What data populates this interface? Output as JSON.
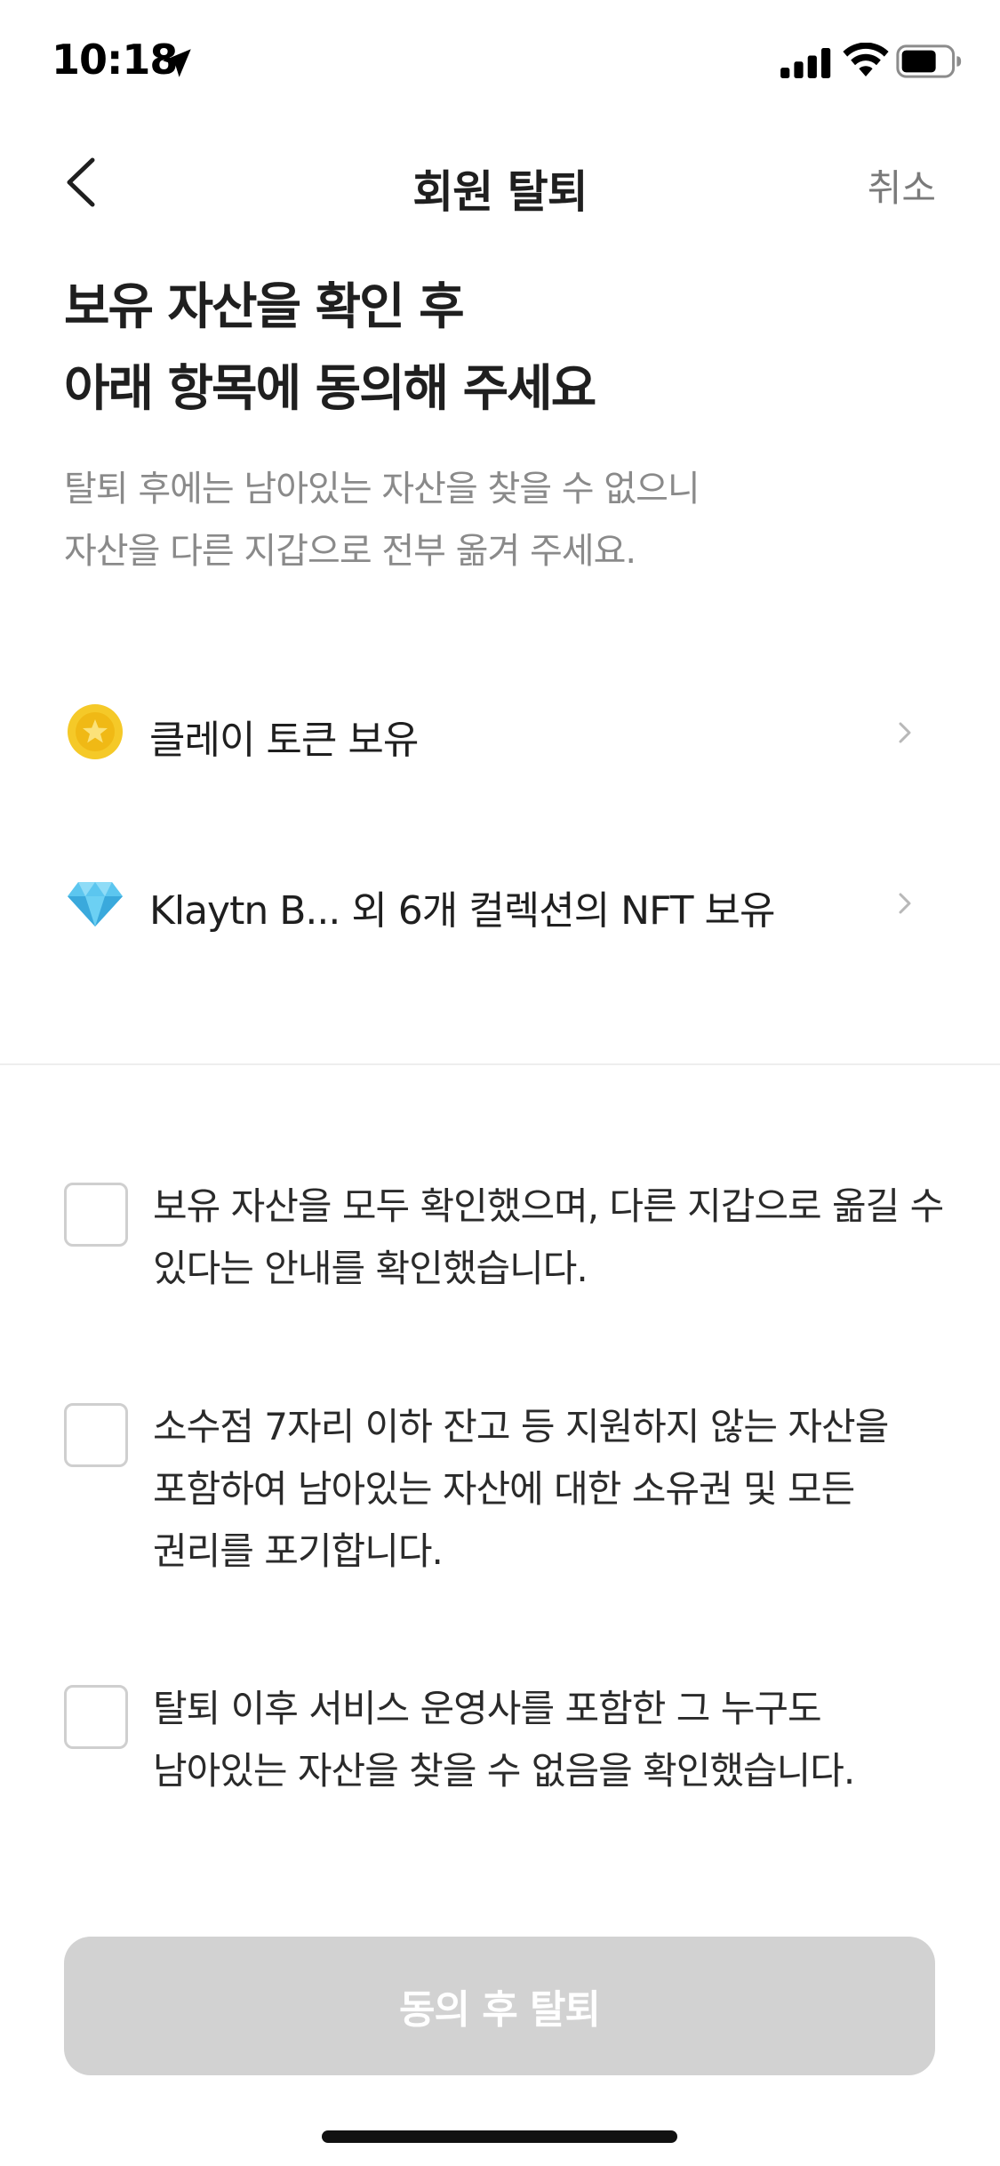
{
  "status_bar": {
    "time": "10:18",
    "icons": [
      "location-arrow-icon",
      "cellular-signal-icon",
      "wifi-icon",
      "battery-icon"
    ]
  },
  "nav": {
    "title": "회원 탈퇴",
    "cancel_label": "취소",
    "back_icon": "chevron-left-icon"
  },
  "heading": {
    "line1": "보유 자산을 확인 후",
    "line2": "아래 항목에 동의해 주세요"
  },
  "subtext": {
    "line1": "탈퇴 후에는 남아있는 자산을 찾을 수 없으니",
    "line2": "자산을 다른 지갑으로 전부 옮겨 주세요."
  },
  "assets": [
    {
      "icon": "coin-icon",
      "label": "클레이 토큰 보유"
    },
    {
      "icon": "diamond-icon",
      "label": "Klaytn B... 외 6개 컬렉션의 NFT 보유"
    }
  ],
  "consents": [
    {
      "line1": "보유 자산을 모두 확인했으며, 다른 지갑으로 옮길 수",
      "line2": "있다는 안내를 확인했습니다.",
      "line3": "",
      "checked": false
    },
    {
      "line1": "소수점 7자리 이하 잔고 등 지원하지 않는 자산을",
      "line2": "포함하여 남아있는 자산에 대한 소유권 및 모든",
      "line3": "권리를 포기합니다.",
      "checked": false
    },
    {
      "line1": "탈퇴 이후 서비스 운영사를 포함한 그 누구도",
      "line2": "남아있는 자산을 찾을 수 없음을 확인했습니다.",
      "line3": "",
      "checked": false
    }
  ],
  "submit": {
    "label": "동의 후 탈퇴",
    "disabled": true
  },
  "colors": {
    "button_disabled": "#d2d2d2",
    "secondary_text": "#8a8a8a",
    "coin": "#f5c928",
    "diamond": "#5cc6ef"
  }
}
